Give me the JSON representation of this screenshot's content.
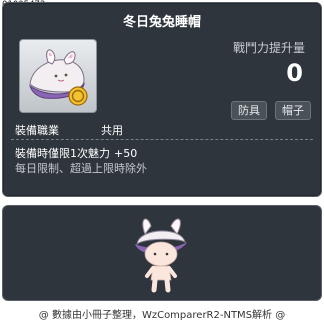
{
  "item": {
    "id": "01005473",
    "name": "冬日兔兔睡帽",
    "potential_label": "戰鬥力提升量",
    "potential_value": "0",
    "tags": [
      "防具",
      "帽子"
    ],
    "job_label": "裝備職業",
    "job_value": "共用",
    "equip_effect_label": "裝備時僅限1次魅力",
    "equip_effect_value": "+50",
    "description": "每日限制、超過上限時除外"
  },
  "footer": {
    "text": "@ 數據由小冊子整理，WzComparerR2-NTMS解析 @"
  },
  "icons": {
    "item_icon": "bunny-sleeping-cap-icon",
    "preview": "character-preview-icon"
  },
  "colors": {
    "panel_bg": "#2e353c",
    "title": "#ffffff",
    "tag_bg": "#4a5259"
  }
}
